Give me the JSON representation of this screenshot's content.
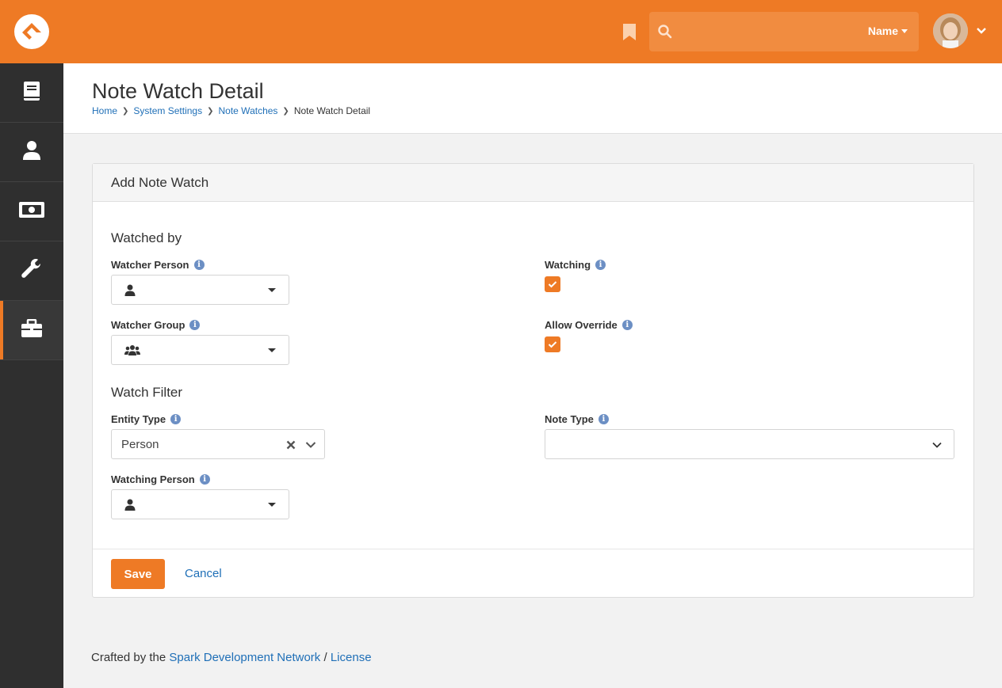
{
  "header": {
    "search_placeholder": "",
    "search_scope": "Name"
  },
  "page": {
    "title": "Note Watch Detail",
    "breadcrumbs": [
      "Home",
      "System Settings",
      "Note Watches",
      "Note Watch Detail"
    ]
  },
  "panel": {
    "title": "Add Note Watch",
    "watched_by_section": "Watched by",
    "watcher_person_label": "Watcher Person",
    "watcher_group_label": "Watcher Group",
    "watching_label": "Watching",
    "watching_checked": true,
    "allow_override_label": "Allow Override",
    "allow_override_checked": true,
    "watch_filter_section": "Watch Filter",
    "entity_type_label": "Entity Type",
    "entity_type_value": "Person",
    "note_type_label": "Note Type",
    "note_type_value": "",
    "watching_person_label": "Watching Person",
    "save_label": "Save",
    "cancel_label": "Cancel"
  },
  "footer": {
    "prefix": "Crafted by the",
    "link": "Spark Development Network",
    "separator": "/",
    "license": "License"
  },
  "colors": {
    "accent": "#ee7a25",
    "sidebar": "#2f2f2f",
    "link": "#1f6fb7"
  }
}
